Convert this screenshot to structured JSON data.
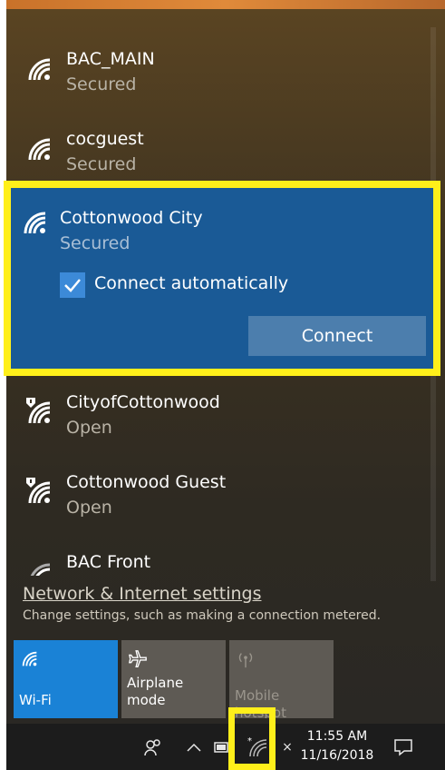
{
  "networks_top": [
    {
      "name": "BAC_MAIN",
      "status": "Secured",
      "type": "wifi"
    },
    {
      "name": "cocguest",
      "status": "Secured",
      "type": "wifi"
    }
  ],
  "selected_network": {
    "name": "Cottonwood City",
    "status": "Secured",
    "auto_connect_label": "Connect automatically",
    "auto_connect_checked": true,
    "connect_label": "Connect"
  },
  "networks_bottom": [
    {
      "name": "CityofCottonwood",
      "status": "Open",
      "type": "wifi-open"
    },
    {
      "name": "Cottonwood Guest",
      "status": "Open",
      "type": "wifi-open"
    },
    {
      "name": "BAC Front",
      "status": "",
      "type": "wifi-weak"
    }
  ],
  "settings": {
    "link": "Network & Internet settings",
    "description": "Change settings, such as making a connection metered."
  },
  "quick_actions": [
    {
      "label": "Wi-Fi",
      "active": true,
      "icon": "wifi-icon"
    },
    {
      "label": "Airplane mode",
      "active": false,
      "icon": "airplane-icon"
    },
    {
      "label": "Mobile hotspot",
      "active": false,
      "disabled": true,
      "icon": "hotspot-icon"
    }
  ],
  "taskbar": {
    "time": "11:55 AM",
    "date": "11/16/2018"
  },
  "colors": {
    "selected_bg": "#1a5a96",
    "highlight": "#ffef1a",
    "wifi_tile": "#1a82d6"
  }
}
